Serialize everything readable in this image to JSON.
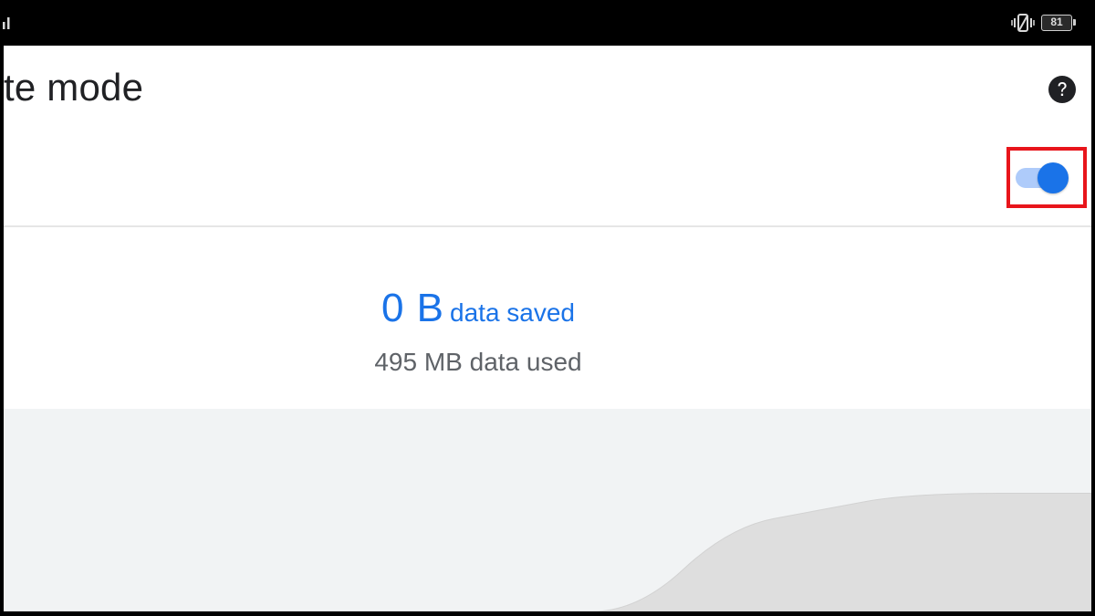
{
  "status_bar": {
    "battery_level": "81",
    "icons": [
      "signal-icon",
      "vibrate-icon",
      "battery-icon"
    ]
  },
  "header": {
    "title": "te mode",
    "help_icon": "help-icon"
  },
  "toggle": {
    "state": "on",
    "highlighted": true,
    "accent_color": "#1a73e8",
    "track_color": "#aecbfa",
    "highlight_color": "#e8151b"
  },
  "stats": {
    "saved_amount": "0 B",
    "saved_label": "data saved",
    "used_text": "495 MB data used"
  },
  "chart_data": {
    "type": "area",
    "fill_color": "#dedede",
    "background_color": "#f1f3f4",
    "series": [
      {
        "x": [
          0,
          1,
          2,
          3,
          4,
          5,
          6,
          7,
          8,
          9,
          10
        ],
        "values": [
          0,
          0,
          0,
          0,
          0,
          0,
          0,
          0,
          5,
          6,
          7
        ]
      }
    ]
  }
}
